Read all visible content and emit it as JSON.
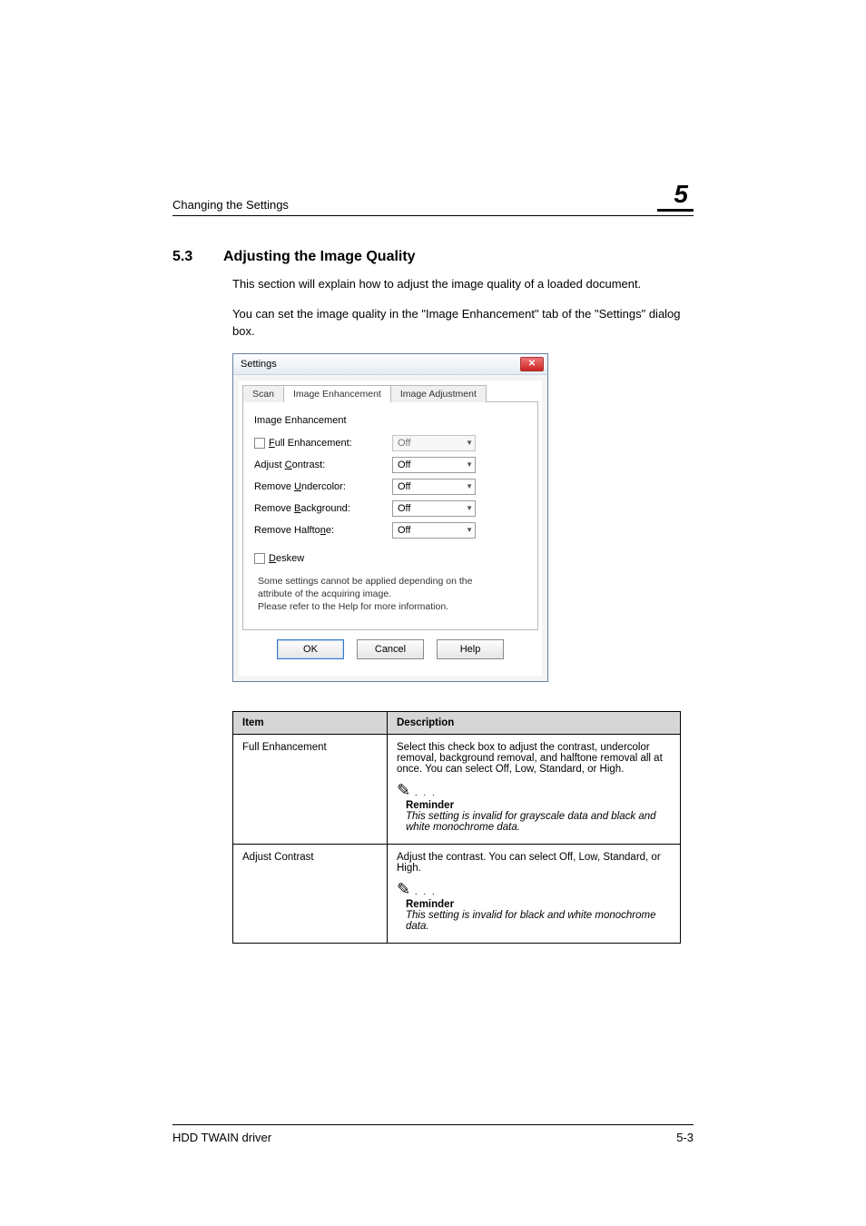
{
  "page": {
    "running_head": "Changing the Settings",
    "chapter_number": "5",
    "footer_left": "HDD TWAIN driver",
    "footer_right": "5-3"
  },
  "section": {
    "number": "5.3",
    "title": "Adjusting the Image Quality",
    "para1": "This section will explain how to adjust the image quality of a loaded document.",
    "para2": "You can set the image quality in the \"Image Enhancement\" tab of the \"Settings\" dialog box."
  },
  "dialog": {
    "title": "Settings",
    "tabs": {
      "scan": "Scan",
      "enh": "Image Enhancement",
      "adj": "Image Adjustment"
    },
    "group_label": "Image Enhancement",
    "rows": {
      "full": {
        "label_pre": "F",
        "label_rest": "ull Enhancement:",
        "value": "Off"
      },
      "contrast": {
        "label_pre": "Adjust ",
        "label_ul": "C",
        "label_post": "ontrast:",
        "value": "Off"
      },
      "undercolor": {
        "label_pre": "Remove ",
        "label_ul": "U",
        "label_post": "ndercolor:",
        "value": "Off"
      },
      "background": {
        "label_pre": "Remove ",
        "label_ul": "B",
        "label_post": "ackground:",
        "value": "Off"
      },
      "halftone": {
        "label_pre": "Remove Halfto",
        "label_ul": "n",
        "label_post": "e:",
        "value": "Off"
      }
    },
    "deskew": {
      "label_ul": "D",
      "label_post": "eskew"
    },
    "note_l1": "Some settings cannot be applied depending on the",
    "note_l2": "attribute of the acquiring image.",
    "note_l3": "Please refer to the Help for more information.",
    "buttons": {
      "ok": "OK",
      "cancel": "Cancel",
      "help": "Help"
    }
  },
  "table": {
    "head_item": "Item",
    "head_desc": "Description",
    "rows": [
      {
        "item": "Full Enhancement",
        "desc": "Select this check box to adjust the contrast, undercolor removal, background removal, and halftone removal all at once. You can select Off, Low, Standard, or High.",
        "reminder_title": "Reminder",
        "reminder_body": "This setting is invalid for grayscale data and black and white monochrome data."
      },
      {
        "item": "Adjust Contrast",
        "desc": "Adjust the contrast. You can select Off, Low, Standard, or High.",
        "reminder_title": "Reminder",
        "reminder_body": "This setting is invalid for black and white monochrome data."
      }
    ]
  }
}
